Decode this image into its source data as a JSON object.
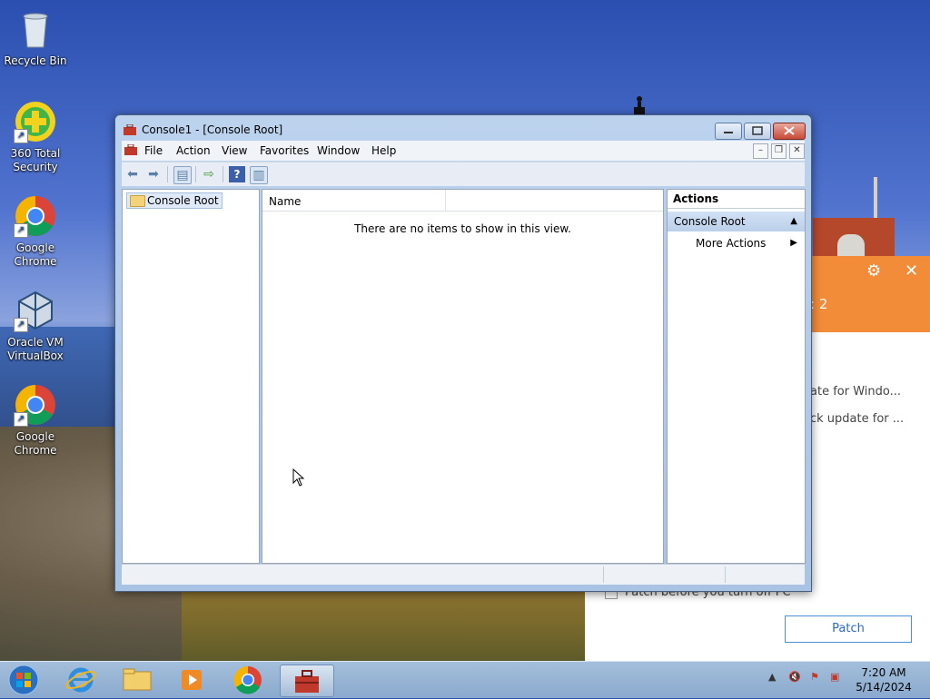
{
  "desktop": {
    "icons": [
      {
        "label": "Recycle Bin"
      },
      {
        "label": "360 Total Security"
      },
      {
        "label": "Google Chrome"
      },
      {
        "label": "Oracle VM VirtualBox"
      },
      {
        "label": "Google Chrome"
      }
    ]
  },
  "background_app": {
    "title_fragment": ": 2",
    "line1": "ate for Windo...",
    "line2": "ck update for ...",
    "checkbox_label": "Patch before you turn off PC",
    "patch_button": "Patch"
  },
  "window": {
    "title": "Console1 - [Console Root]",
    "menu": [
      "File",
      "Action",
      "View",
      "Favorites",
      "Window",
      "Help"
    ],
    "tree_root": "Console Root",
    "list_column": "Name",
    "empty_message": "There are no items to show in this view.",
    "actions": {
      "header": "Actions",
      "section": "Console Root",
      "item": "More Actions"
    }
  },
  "taskbar": {
    "time": "7:20 AM",
    "date": "5/14/2024"
  },
  "colors": {
    "accent_orange": "#f28c38",
    "selection": "#dfe9f7"
  }
}
